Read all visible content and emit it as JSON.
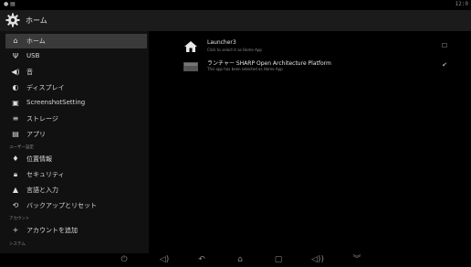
{
  "status_bar": {
    "time": "12:0"
  },
  "action_bar": {
    "title": "ホーム"
  },
  "sidebar": {
    "items": [
      {
        "label": "ホーム",
        "icon": "home-icon",
        "selected": true
      },
      {
        "label": "USB",
        "icon": "usb-icon"
      },
      {
        "label": "音",
        "icon": "volume-icon"
      },
      {
        "label": "ディスプレイ",
        "icon": "display-icon"
      },
      {
        "label": "ScreenshotSetting",
        "icon": "screenshot-icon"
      },
      {
        "label": "ストレージ",
        "icon": "storage-icon"
      },
      {
        "label": "アプリ",
        "icon": "apps-icon"
      }
    ],
    "section_user": "ユーザー設定",
    "user_items": [
      {
        "label": "位置情報",
        "icon": "location-icon"
      },
      {
        "label": "セキュリティ",
        "icon": "lock-icon"
      },
      {
        "label": "言語と入力",
        "icon": "language-icon"
      },
      {
        "label": "バックアップとリセット",
        "icon": "backup-icon"
      }
    ],
    "section_account": "アカウント",
    "account_items": [
      {
        "label": "アカウントを追加",
        "icon": "add-icon"
      }
    ],
    "section_system": "システム"
  },
  "apps": [
    {
      "name": "Launcher3",
      "subtitle": "Click to select it as Home App",
      "selected": false
    },
    {
      "name": "ランチャー SHARP Open Architecture Platform",
      "subtitle": "This app has been selected as Home App",
      "selected": true
    }
  ],
  "nav_bar": {
    "buttons": [
      "power-icon",
      "volume-down-icon",
      "back-icon",
      "home-icon",
      "recents-icon",
      "volume-up-icon",
      "collapse-icon"
    ]
  },
  "colors": {
    "selected_bg": "#3a3a3a",
    "action_bar_bg": "#1b1b1b",
    "sidebar_bg": "#111111"
  }
}
